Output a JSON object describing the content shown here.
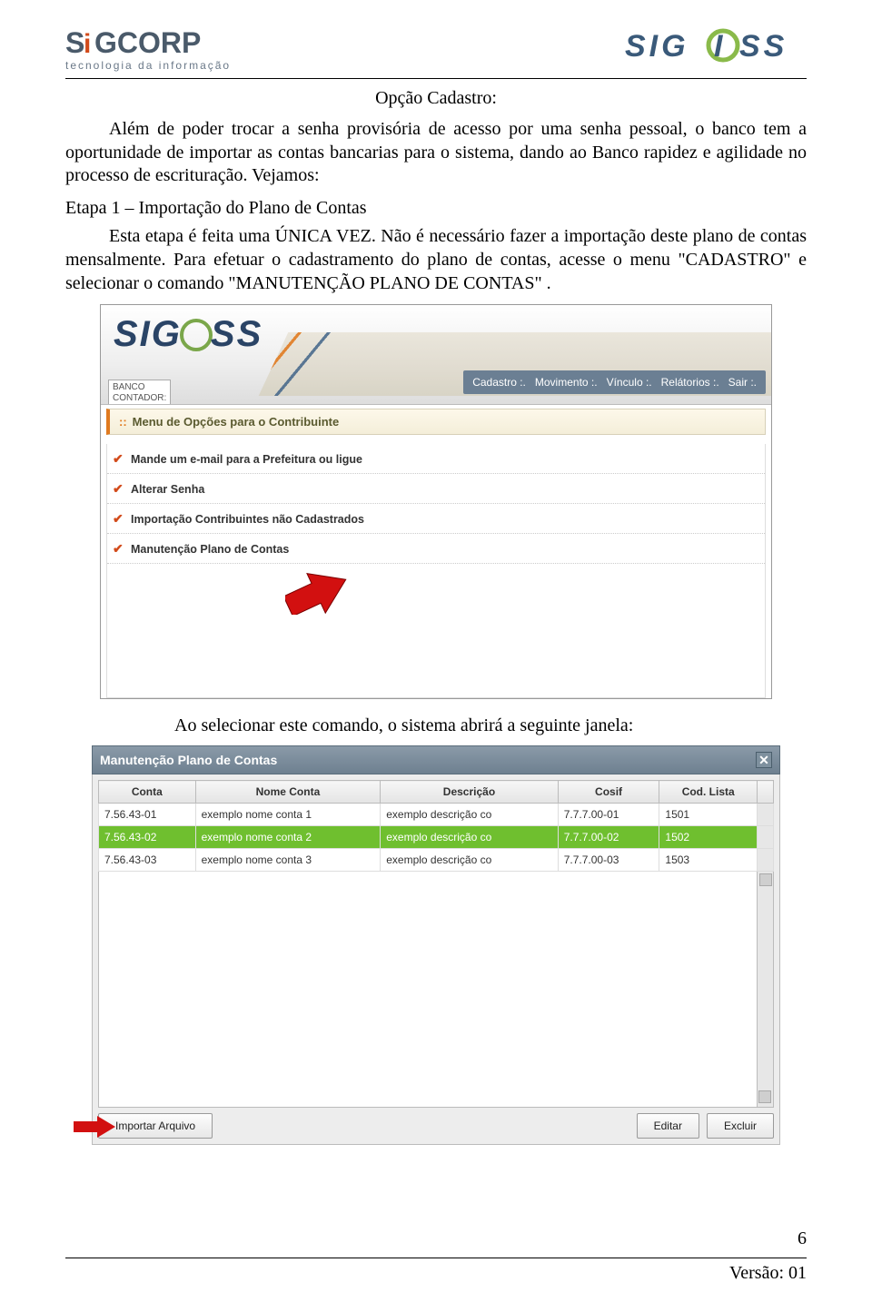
{
  "header": {
    "logo_left_main": "SiGCORP",
    "logo_left_sub": "tecnologia da informação",
    "logo_right": "SIGISS"
  },
  "title": "Opção Cadastro:",
  "para1": "Além de poder trocar a senha provisória de acesso por uma senha pessoal, o banco tem a oportunidade de importar as contas bancarias para o sistema, dando ao Banco rapidez e agilidade no processo de escrituração. Vejamos:",
  "etapa_label": "Etapa 1 – Importação do Plano de Contas",
  "para2": "Esta etapa é feita uma ÚNICA VEZ. Não é necessário fazer a importação deste plano de contas mensalmente. Para efetuar o cadastramento do plano de contas, acesse o menu \"CADASTRO\"  e selecionar o comando \"MANUTENÇÃO PLANO DE CONTAS\" .",
  "fig1": {
    "info_line1": "BANCO",
    "info_line2": "CONTADOR:",
    "nav": [
      "Cadastro :.",
      "Movimento :.",
      "Vínculo :.",
      "Relátorios :.",
      "Sair :."
    ],
    "menu_title": "Menu de Opções para o Contribuinte",
    "items": [
      "Mande um e-mail para a Prefeitura ou ligue",
      "Alterar Senha",
      "Importação Contribuintes não Cadastrados",
      "Manutenção Plano de Contas"
    ]
  },
  "caption": "Ao selecionar este comando, o sistema abrirá a seguinte janela:",
  "fig2": {
    "title": "Manutenção Plano de Contas",
    "cols": [
      "Conta",
      "Nome Conta",
      "Descrição",
      "Cosif",
      "Cod. Lista"
    ],
    "rows": [
      {
        "c": [
          "7.56.43-01",
          "exemplo nome conta 1",
          "exemplo descrição co",
          "7.7.7.00-01",
          "1501"
        ],
        "sel": false
      },
      {
        "c": [
          "7.56.43-02",
          "exemplo nome conta 2",
          "exemplo descrição co",
          "7.7.7.00-02",
          "1502"
        ],
        "sel": true
      },
      {
        "c": [
          "7.56.43-03",
          "exemplo nome conta 3",
          "exemplo descrição co",
          "7.7.7.00-03",
          "1503"
        ],
        "sel": false
      }
    ],
    "buttons": {
      "import": "Importar Arquivo",
      "edit": "Editar",
      "del": "Excluir"
    }
  },
  "page_number": "6",
  "version": "Versão: 01"
}
